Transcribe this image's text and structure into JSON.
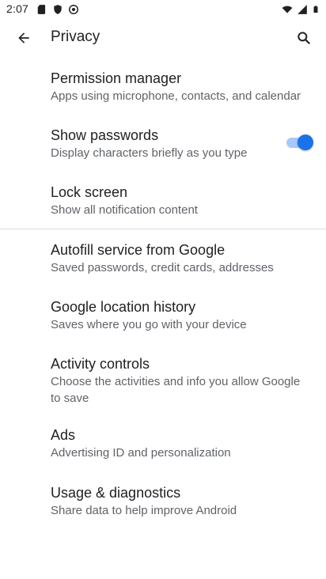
{
  "status_bar": {
    "time": "2:07"
  },
  "app_bar": {
    "title": "Privacy"
  },
  "items": [
    {
      "title": "Permission manager",
      "subtitle": "Apps using microphone, contacts, and calendar"
    },
    {
      "title": "Show passwords",
      "subtitle": "Display characters briefly as you type",
      "toggle_on": true
    },
    {
      "title": "Lock screen",
      "subtitle": "Show all notification content"
    },
    {
      "title": "Autofill service from Google",
      "subtitle": "Saved passwords, credit cards, addresses"
    },
    {
      "title": "Google location history",
      "subtitle": "Saves where you go with your device"
    },
    {
      "title": "Activity controls",
      "subtitle": "Choose the activities and info you allow Google to save"
    },
    {
      "title": "Ads",
      "subtitle": "Advertising ID and personalization"
    },
    {
      "title": "Usage & diagnostics",
      "subtitle": "Share data to help improve Android"
    }
  ],
  "colors": {
    "accent": "#1a73e8",
    "track": "#a8c7fa",
    "divider": "#dadce0"
  },
  "icons": {
    "back": "arrow-back-icon",
    "search": "search-icon"
  }
}
